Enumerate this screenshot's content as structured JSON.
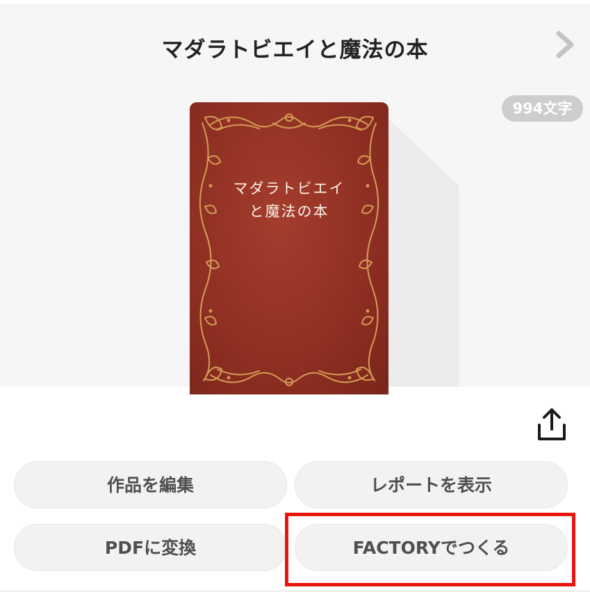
{
  "header": {
    "title": "マダラトビエイと魔法の本",
    "next_icon": "chevron-right-icon"
  },
  "badge": {
    "char_count": "994文字"
  },
  "book": {
    "cover_title": "マダラトビエイ\nと魔法の本",
    "cover_color": "#8f3023",
    "ornament_color": "#d9a45a"
  },
  "actions": {
    "share_icon": "share-icon",
    "edit_label": "作品を編集",
    "report_label": "レポートを表示",
    "pdf_label": "PDFに変換",
    "factory_label": "FACTORYでつくる"
  },
  "colors": {
    "highlight": "#e8160f",
    "button_bg": "#f2f2f2",
    "button_text": "#4f4f4f",
    "badge_bg": "#cdcdcd"
  }
}
